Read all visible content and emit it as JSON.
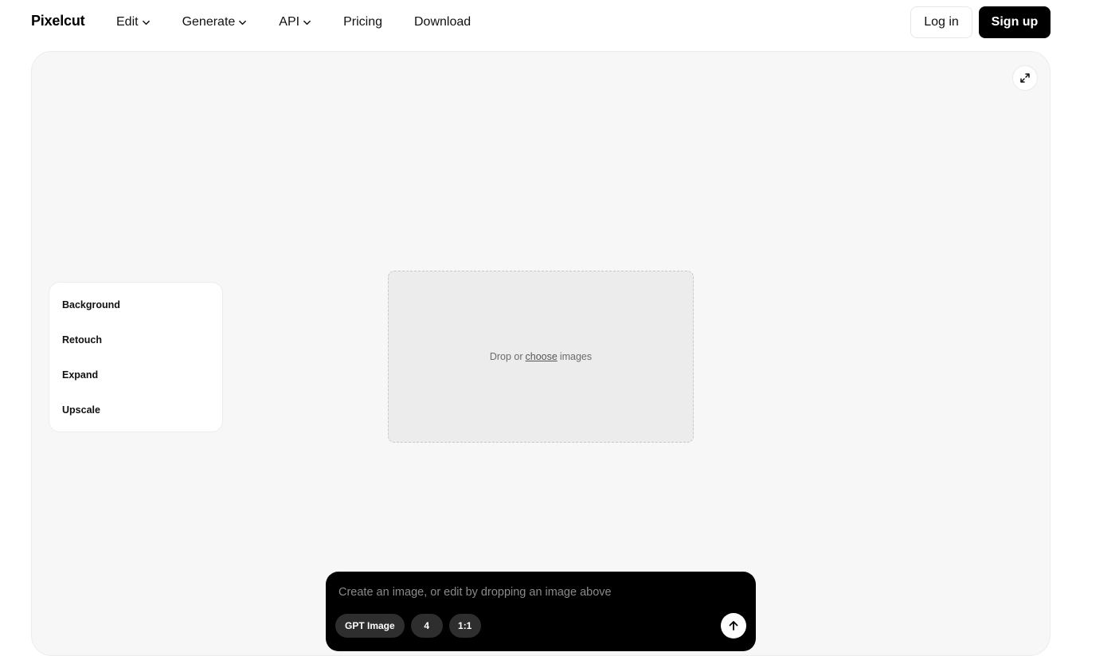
{
  "brand": {
    "name": "Pixelcut"
  },
  "nav": {
    "items": [
      {
        "label": "Edit",
        "dropdown": true
      },
      {
        "label": "Generate",
        "dropdown": true
      },
      {
        "label": "API",
        "dropdown": true
      },
      {
        "label": "Pricing",
        "dropdown": false
      },
      {
        "label": "Download",
        "dropdown": false
      }
    ],
    "login_label": "Log in",
    "signup_label": "Sign up"
  },
  "canvas": {
    "expand_icon": "expand-arrows-icon",
    "tools": [
      {
        "label": "Background"
      },
      {
        "label": "Retouch"
      },
      {
        "label": "Expand"
      },
      {
        "label": "Upscale"
      }
    ],
    "dropzone": {
      "prefix": "Drop or",
      "link": "choose",
      "suffix": "images"
    }
  },
  "prompt": {
    "placeholder": "Create an image, or edit by dropping an image above",
    "value": "",
    "model_chip": "GPT Image",
    "count_chip": "4",
    "ratio_chip": "1:1",
    "send_icon": "arrow-up-icon"
  },
  "colors": {
    "primary": "#000000",
    "canvas_bg": "#f7f7f7",
    "dropzone_bg": "#ececec",
    "chip_bg": "#2e2e2e"
  }
}
